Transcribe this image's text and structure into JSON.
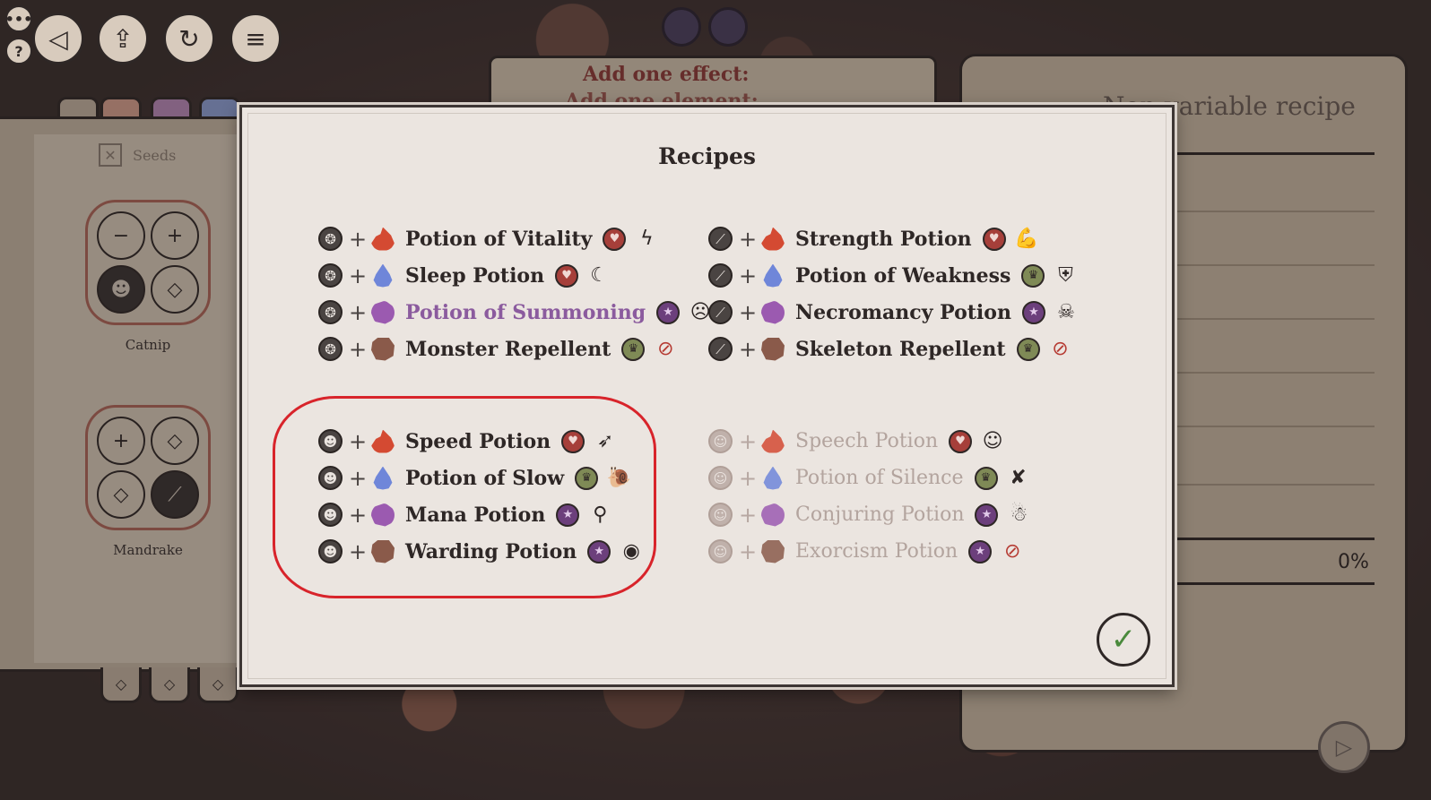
{
  "toolbar": {
    "menu_dots": "•••",
    "help": "?",
    "back": "◁",
    "upload": "⇪",
    "refresh": "↻",
    "menu": "≡"
  },
  "scroll": {
    "line1": "Add one effect:",
    "line2": "Add one element:"
  },
  "left_book": {
    "seeds_label": "Seeds",
    "seeds_close_icon": "✕",
    "plants": [
      {
        "name": "Catnip",
        "cells": [
          "−",
          "+",
          "☻",
          "◇"
        ]
      },
      {
        "name": "Mandrake",
        "cells": [
          "+",
          "◇",
          "◇",
          "⟋"
        ]
      }
    ],
    "back_arrow": "←",
    "bottom_tabs": [
      "◇",
      "◇",
      "◇"
    ]
  },
  "right_book": {
    "title": "Non-variable recipe",
    "percent": "0%",
    "next": "▷"
  },
  "modal": {
    "title": "Recipes",
    "confirm": "✓",
    "groups": [
      {
        "base_icon": "dragon-icon",
        "base_glyph": "❂",
        "dim": false,
        "recipes": [
          {
            "element": "fire",
            "name": "Potion of Vitality",
            "tag": "heart",
            "tag_glyph": "♥",
            "effect": "ϟ",
            "highlight": false
          },
          {
            "element": "water",
            "name": "Sleep Potion",
            "tag": "heart",
            "tag_glyph": "♥",
            "effect": "☾",
            "highlight": false
          },
          {
            "element": "arcane",
            "name": "Potion of Summoning",
            "tag": "star",
            "tag_glyph": "★",
            "effect": "☹",
            "highlight": true
          },
          {
            "element": "earth",
            "name": "Monster Repellent",
            "tag": "crown",
            "tag_glyph": "♛",
            "effect": "⊘",
            "highlight": false
          }
        ]
      },
      {
        "base_icon": "bone-icon",
        "base_glyph": "⟋",
        "dim": false,
        "recipes": [
          {
            "element": "fire",
            "name": "Strength Potion",
            "tag": "heart",
            "tag_glyph": "♥",
            "effect": "💪",
            "highlight": false
          },
          {
            "element": "water",
            "name": "Potion of Weakness",
            "tag": "crown",
            "tag_glyph": "♛",
            "effect": "⛨",
            "highlight": false
          },
          {
            "element": "arcane",
            "name": "Necromancy Potion",
            "tag": "star",
            "tag_glyph": "★",
            "effect": "☠",
            "highlight": false
          },
          {
            "element": "earth",
            "name": "Skeleton Repellent",
            "tag": "crown",
            "tag_glyph": "♛",
            "effect": "⊘",
            "highlight": false
          }
        ]
      },
      {
        "base_icon": "cat-icon",
        "base_glyph": "☻",
        "dim": false,
        "recipes": [
          {
            "element": "fire",
            "name": "Speed Potion",
            "tag": "heart",
            "tag_glyph": "♥",
            "effect": "➶",
            "highlight": false
          },
          {
            "element": "water",
            "name": "Potion of Slow",
            "tag": "crown",
            "tag_glyph": "♛",
            "effect": "🐌",
            "highlight": false
          },
          {
            "element": "arcane",
            "name": "Mana Potion",
            "tag": "star",
            "tag_glyph": "★",
            "effect": "⚲",
            "highlight": false
          },
          {
            "element": "earth",
            "name": "Warding Potion",
            "tag": "star",
            "tag_glyph": "★",
            "effect": "◉",
            "highlight": false
          }
        ]
      },
      {
        "base_icon": "ghost-icon",
        "base_glyph": "☺",
        "dim": true,
        "recipes": [
          {
            "element": "fire",
            "name": "Speech Potion",
            "tag": "heart",
            "tag_glyph": "♥",
            "effect": "☺",
            "highlight": false
          },
          {
            "element": "water",
            "name": "Potion of Silence",
            "tag": "crown",
            "tag_glyph": "♛",
            "effect": "✘",
            "highlight": false
          },
          {
            "element": "arcane",
            "name": "Conjuring Potion",
            "tag": "star",
            "tag_glyph": "★",
            "effect": "☃",
            "highlight": false
          },
          {
            "element": "earth",
            "name": "Exorcism Potion",
            "tag": "star",
            "tag_glyph": "★",
            "effect": "⊘",
            "highlight": false
          }
        ]
      }
    ]
  },
  "colors": {
    "highlight_oval": "#d8242b",
    "summoning_text": "#8b5b9e",
    "confirm_check": "#4a8a3c"
  }
}
